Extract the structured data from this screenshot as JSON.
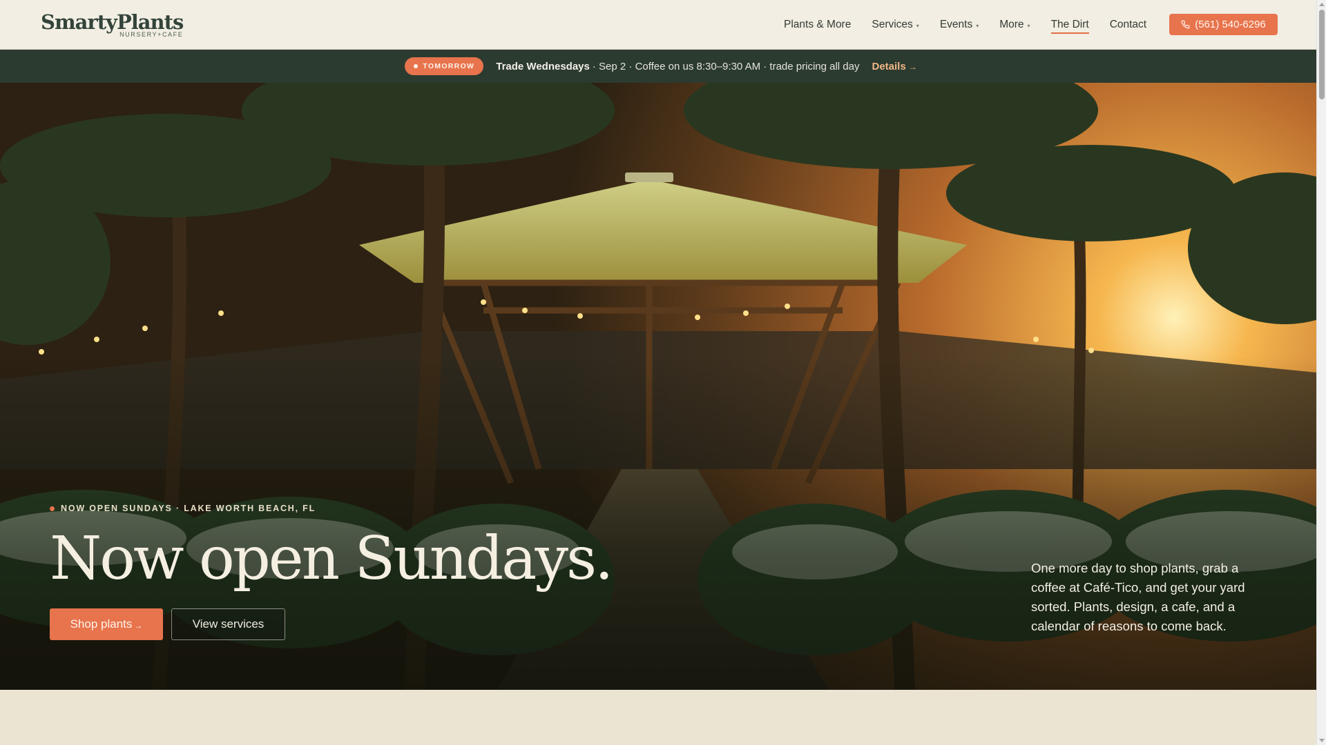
{
  "header": {
    "logo_text": "SmartyPlants",
    "logo_subtext": "NURSERY+CAFE",
    "nav": [
      {
        "label": "Plants & More",
        "has_dropdown": false
      },
      {
        "label": "Services",
        "has_dropdown": true
      },
      {
        "label": "Events",
        "has_dropdown": true
      },
      {
        "label": "More",
        "has_dropdown": true
      },
      {
        "label": "The Dirt",
        "has_dropdown": false,
        "active": true
      },
      {
        "label": "Contact",
        "has_dropdown": false
      }
    ],
    "phone_label": "(561) 540-6296",
    "dropdown_caret": "▾"
  },
  "announcement": {
    "badge": "TOMORROW",
    "title": "Trade Wednesdays",
    "text": "· Sep 2 · Coffee on us 8:30–9:30 AM · trade pricing all day",
    "link_label": "Details",
    "link_arrow": "→"
  },
  "hero": {
    "eyebrow": "NOW OPEN SUNDAYS · LAKE WORTH BEACH, FL",
    "title": "Now open Sundays.",
    "primary_button": "Shop plants",
    "primary_arrow": "→",
    "secondary_button": "View services",
    "description": "One more day to shop plants, grab a coffee at Café-Tico, and get your yard sorted. Plants, design, a cafe, and a calendar of reasons to come back."
  },
  "colors": {
    "accent": "#e7744d",
    "header_bg": "#f2eee4",
    "announce_bg": "#2c3b30",
    "page_bg": "#ebe4d3"
  },
  "icons": {
    "phone": "phone-icon"
  }
}
